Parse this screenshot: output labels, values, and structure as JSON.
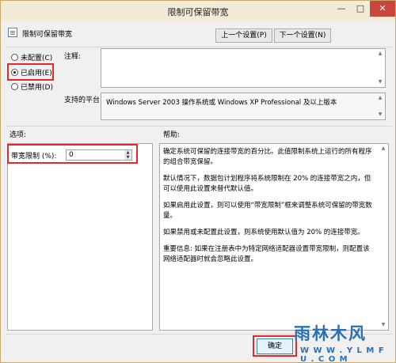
{
  "window": {
    "title": "限制可保留带宽",
    "minimize": "—",
    "maximize": "□",
    "close": "✕"
  },
  "header": {
    "policy_name": "限制可保留带宽",
    "prev_button": "上一个设置(P)",
    "next_button": "下一个设置(N)"
  },
  "state": {
    "options": [
      {
        "label": "未配置(C)",
        "selected": false
      },
      {
        "label": "已启用(E)",
        "selected": true
      },
      {
        "label": "已禁用(D)",
        "selected": false
      }
    ]
  },
  "comment": {
    "label": "注释:",
    "value": ""
  },
  "platform": {
    "label": "支持的平台:",
    "value": "Windows Server 2003 操作系统或 Windows XP Professional 及以上版本"
  },
  "options_section": {
    "label": "选项:",
    "bandwidth_label": "带宽限制 (%):",
    "bandwidth_value": "0"
  },
  "help_section": {
    "label": "帮助:",
    "paragraphs": [
      "确定系统可保留的连接带宽的百分比。此值限制系统上运行的所有程序的组合带宽保留。",
      "默认情况下，数据包计划程序将系统限制在 20% 的连接带宽之内，但可以使用此设置来替代默认值。",
      "如果启用此设置，则可以使用“带宽限制”框来调整系统可保留的带宽数量。",
      "如果禁用或未配置此设置，则系统使用默认值为 20% 的连接带宽。",
      "重要信息: 如果在注册表中为特定网络适配器设置带宽限制，则配置该网络适配器时就会忽略此设置。"
    ]
  },
  "footer": {
    "ok_button": "确定"
  },
  "watermark": {
    "brand": "雨林木风",
    "url": "W W W . Y L M F U . C O M"
  }
}
